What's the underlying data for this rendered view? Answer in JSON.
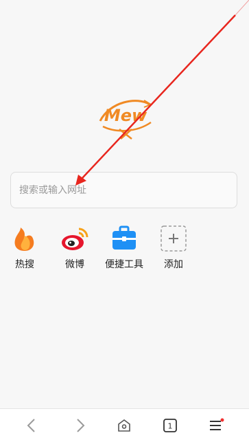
{
  "app": {
    "logo_text": "Mew"
  },
  "search": {
    "placeholder": "搜索或输入网址"
  },
  "shortcuts": [
    {
      "label": "热搜",
      "icon": "flame-icon"
    },
    {
      "label": "微博",
      "icon": "weibo-icon"
    },
    {
      "label": "便捷工具",
      "icon": "toolbox-icon"
    },
    {
      "label": "添加",
      "icon": "add-icon"
    }
  ],
  "bottom_bar": {
    "tab_count": "1",
    "icons": [
      "back-icon",
      "forward-icon",
      "home-icon",
      "tabs-icon",
      "menu-icon"
    ]
  },
  "colors": {
    "accent": "#f08a24",
    "annotation_arrow": "#e8261e",
    "notification_dot": "#f03030"
  }
}
